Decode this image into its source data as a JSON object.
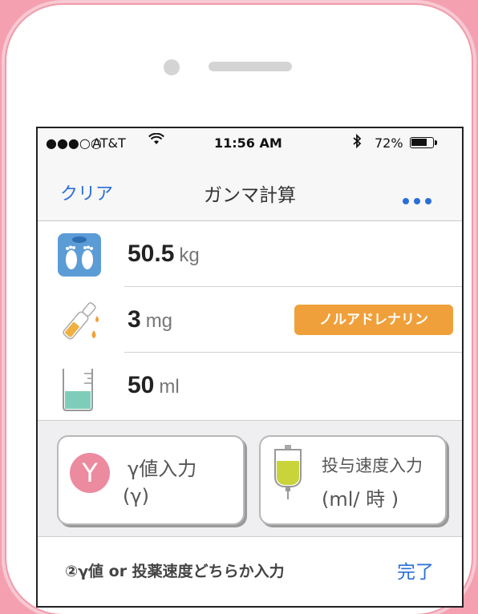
{
  "status_bar": {
    "signal": "●●●○○",
    "carrier": "AT&T",
    "wifi_icon": "wifi-icon",
    "time": "11:56 AM",
    "bluetooth": "✱",
    "battery_percent": "72%",
    "battery_level": 0.72
  },
  "nav": {
    "left_button": "クリア",
    "title": "ガンマ計算",
    "more_icon": "more-icon"
  },
  "inputs": {
    "weight": {
      "icon": "scale-icon",
      "value": "50.5",
      "unit": "kg"
    },
    "drug": {
      "icon": "ampoule-icon",
      "value": "3",
      "unit": "mg",
      "drug_name": "ノルアドレナリン"
    },
    "volume": {
      "icon": "beaker-icon",
      "value": "50",
      "unit": "ml"
    }
  },
  "mode_cards": {
    "gamma": {
      "icon_text": "Y",
      "line1": "γ値入力",
      "line2": "(γ)"
    },
    "rate": {
      "line1": "投与速度入力",
      "line2": "(ml/ 時 )"
    }
  },
  "footer": {
    "hint": "②γ値 or 投薬速度どちらか入力",
    "done_label": "完了"
  },
  "colors": {
    "background": "#f5a0b0",
    "accent_blue": "#2a6fd6",
    "badge_orange": "#f0a03a",
    "gamma_pink": "#ec8aa0",
    "liquid_teal": "#7ecdbb",
    "iv_yellow": "#c9d43a"
  }
}
